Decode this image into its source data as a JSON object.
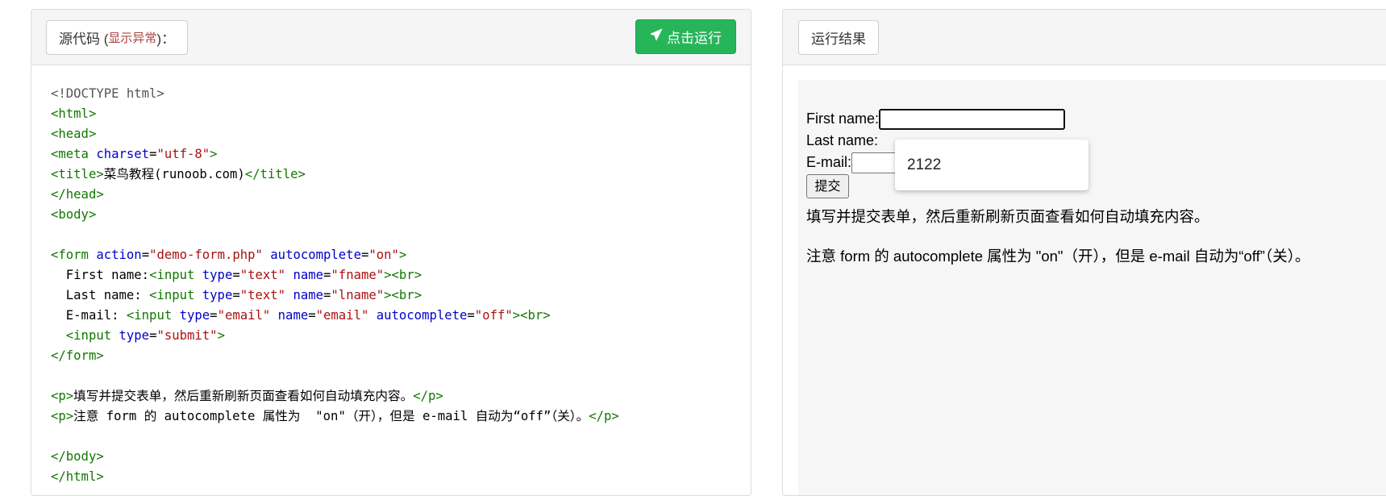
{
  "editor": {
    "header": {
      "source_label": "源代码 (",
      "source_error": "显示异常",
      "source_suffix": ")：",
      "run_label": "点击运行"
    },
    "code_lines": [
      [
        [
          "dt",
          "<!DOCTYPE html>"
        ]
      ],
      [
        [
          "tg",
          "<html>"
        ]
      ],
      [
        [
          "tg",
          "<head>"
        ]
      ],
      [
        [
          "tg",
          "<meta "
        ],
        [
          "at",
          "charset"
        ],
        [
          "p",
          "="
        ],
        [
          "st",
          "\"utf-8\""
        ],
        [
          "tg",
          ">"
        ]
      ],
      [
        [
          "tg",
          "<title>"
        ],
        [
          "p",
          "菜鸟教程(runoob.com)"
        ],
        [
          "tg",
          "</title>"
        ]
      ],
      [
        [
          "tg",
          "</head>"
        ]
      ],
      [
        [
          "tg",
          "<body>"
        ]
      ],
      [],
      [
        [
          "tg",
          "<form "
        ],
        [
          "at",
          "action"
        ],
        [
          "p",
          "="
        ],
        [
          "st",
          "\"demo-form.php\""
        ],
        [
          "p",
          " "
        ],
        [
          "at",
          "autocomplete"
        ],
        [
          "p",
          "="
        ],
        [
          "st",
          "\"on\""
        ],
        [
          "tg",
          ">"
        ]
      ],
      [
        [
          "p",
          "  First name:"
        ],
        [
          "tg",
          "<input "
        ],
        [
          "at",
          "type"
        ],
        [
          "p",
          "="
        ],
        [
          "st",
          "\"text\""
        ],
        [
          "p",
          " "
        ],
        [
          "at",
          "name"
        ],
        [
          "p",
          "="
        ],
        [
          "st",
          "\"fname\""
        ],
        [
          "tg",
          "><br>"
        ]
      ],
      [
        [
          "p",
          "  Last name: "
        ],
        [
          "tg",
          "<input "
        ],
        [
          "at",
          "type"
        ],
        [
          "p",
          "="
        ],
        [
          "st",
          "\"text\""
        ],
        [
          "p",
          " "
        ],
        [
          "at",
          "name"
        ],
        [
          "p",
          "="
        ],
        [
          "st",
          "\"lname\""
        ],
        [
          "tg",
          "><br>"
        ]
      ],
      [
        [
          "p",
          "  E-mail: "
        ],
        [
          "tg",
          "<input "
        ],
        [
          "at",
          "type"
        ],
        [
          "p",
          "="
        ],
        [
          "st",
          "\"email\""
        ],
        [
          "p",
          " "
        ],
        [
          "at",
          "name"
        ],
        [
          "p",
          "="
        ],
        [
          "st",
          "\"email\""
        ],
        [
          "p",
          " "
        ],
        [
          "at",
          "autocomplete"
        ],
        [
          "p",
          "="
        ],
        [
          "st",
          "\"off\""
        ],
        [
          "tg",
          "><br>"
        ]
      ],
      [
        [
          "p",
          "  "
        ],
        [
          "tg",
          "<input "
        ],
        [
          "at",
          "type"
        ],
        [
          "p",
          "="
        ],
        [
          "st",
          "\"submit\""
        ],
        [
          "tg",
          ">"
        ]
      ],
      [
        [
          "tg",
          "</form>"
        ]
      ],
      [],
      [
        [
          "tg",
          "<p>"
        ],
        [
          "p",
          "填写并提交表单，然后重新刷新页面查看如何自动填充内容。"
        ],
        [
          "tg",
          "</p>"
        ]
      ],
      [
        [
          "tg",
          "<p>"
        ],
        [
          "p",
          "注意 form 的 autocomplete 属性为  \"on\"（开），但是 e-mail 自动为“off”（关）。"
        ],
        [
          "tg",
          "</p>"
        ]
      ],
      [],
      [
        [
          "tg",
          "</body>"
        ]
      ],
      [
        [
          "tg",
          "</html>"
        ]
      ]
    ]
  },
  "result": {
    "header_label": "运行结果",
    "first_name_label": "First name:",
    "last_name_label": "Last name:",
    "email_label": "E-mail: ",
    "submit_label": "提交",
    "autocomplete_suggestion": "2122",
    "paragraph1": "填写并提交表单，然后重新刷新页面查看如何自动填充内容。",
    "paragraph2": "注意 form 的 autocomplete 属性为 \"on\"（开），但是 e-mail 自动为“off”（关）。"
  },
  "colors": {
    "run_button": "#27b55a",
    "tag": "#117700",
    "attribute": "#0000cc",
    "string": "#aa1111",
    "error_hint": "#a94442"
  },
  "icons": {
    "run_icon": "paper-plane-icon"
  }
}
